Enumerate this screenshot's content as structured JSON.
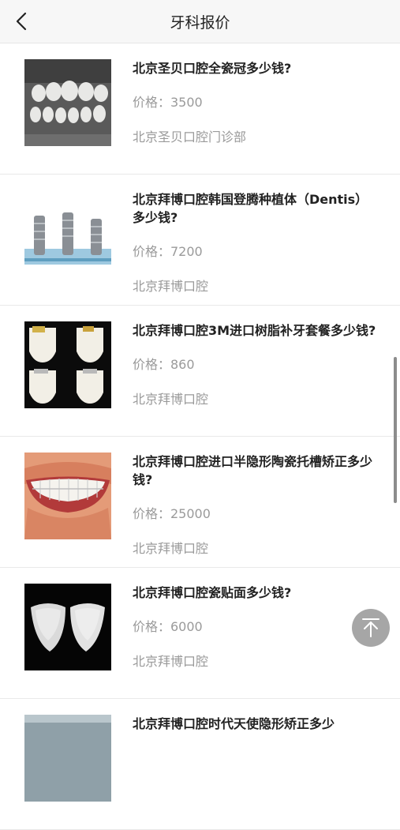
{
  "header": {
    "title": "牙科报价",
    "back_icon": "chevron-left-icon"
  },
  "items": [
    {
      "name": "北京圣贝口腔全瓷冠多少钱?",
      "price": "价格：3500",
      "clinic": "北京圣贝口腔门诊部"
    },
    {
      "name": "北京拜博口腔韩国登腾种植体（Dentis）多少钱?",
      "price": "价格：7200",
      "clinic": "北京拜博口腔"
    },
    {
      "name": "北京拜博口腔3M进口树脂补牙套餐多少钱?",
      "price": "价格：860",
      "clinic": "北京拜博口腔"
    },
    {
      "name": "北京拜博口腔进口半隐形陶瓷托槽矫正多少钱?",
      "price": "价格：25000",
      "clinic": "北京拜博口腔"
    },
    {
      "name": "北京拜博口腔瓷贴面多少钱?",
      "price": "价格：6000",
      "clinic": "北京拜博口腔"
    },
    {
      "name": "北京拜博口腔时代天使隐形矫正多少",
      "price": "",
      "clinic": ""
    }
  ],
  "back_to_top": {
    "icon": "arrow-up-to-top-icon"
  }
}
